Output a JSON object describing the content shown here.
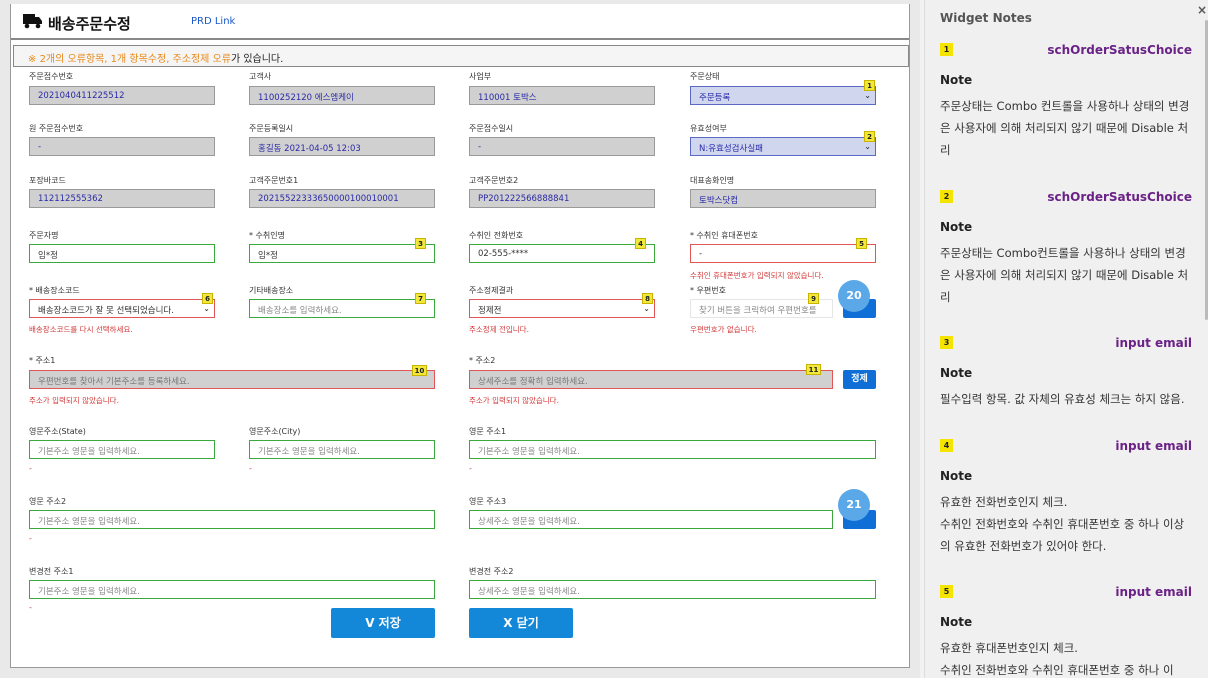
{
  "window": {
    "title": "배송주문수정",
    "prd_link": "PRD Link",
    "error_prefix": "※ ",
    "error_highlight": "2개의 오류항목, 1개 항목수정, 주소정제 오류",
    "error_suffix": "가 있습니다."
  },
  "form": {
    "row1": {
      "order_no": {
        "label": "주문접수번호",
        "value": "2021040411225512"
      },
      "customer": {
        "label": "고객사",
        "value": "1100252120 에스엠케이"
      },
      "business": {
        "label": "사업부",
        "value": "110001 토박스"
      },
      "status": {
        "label": "주문상태",
        "value": "주문등록"
      }
    },
    "row2": {
      "orig_order_no": {
        "label": "원 주문접수번호",
        "value": "-"
      },
      "reg_date": {
        "label": "주문등록일시",
        "value": "홍길동 2021-04-05 12:03"
      },
      "recv_date": {
        "label": "주문접수일시",
        "value": "-"
      },
      "validity": {
        "label": "유효성여부",
        "value": "N:유효성검사실패"
      }
    },
    "row3": {
      "barcode": {
        "label": "포장바코드",
        "value": "112112555362"
      },
      "cust_order_no1": {
        "label": "고객주문번호1",
        "value": "20215522333650000100010001"
      },
      "cust_order_no2": {
        "label": "고객주문번호2",
        "value": "PP201222566888841"
      },
      "shipper": {
        "label": "대표송화인명",
        "value": "토박스닷컴"
      }
    },
    "row4": {
      "orderer": {
        "label": "주문자명",
        "value": "임*정"
      },
      "recipient": {
        "label": "* 수취인명",
        "value": "임*정"
      },
      "phone": {
        "label": "수취인 전화번호",
        "value": "02-555-****"
      },
      "mobile": {
        "label": "* 수취인 휴대폰번호",
        "value": "-",
        "error": "수취인 휴대폰번호가 입력되지 않았습니다."
      }
    },
    "row5": {
      "place_code": {
        "label": "* 배송장소코드",
        "value": "배송장소코드가 잘 못 선택되었습니다.",
        "error": "배송장소코드를 다시 선택하세요."
      },
      "other_place": {
        "label": "기타배송장소",
        "placeholder": "배송장소를 입력하세요."
      },
      "refine_result": {
        "label": "주소정제결과",
        "value": "정제전",
        "error": "주소정제 전입니다."
      },
      "zip": {
        "label": "* 우편번호",
        "placeholder": "찾기 버튼을 크릭하여 우편번호를",
        "error": "우편번호가 없습니다."
      }
    },
    "row6": {
      "addr1": {
        "label": "* 주소1",
        "placeholder": "우편번호를 찾아서 기본주소를 등록하세요.",
        "error": "주소가 입력되지 않았습니다."
      },
      "addr2": {
        "label": "* 주소2",
        "placeholder": "상세주소를 정확히 입력하세요.",
        "error": "주소가 입력되지 않았습니다."
      },
      "refine_button": "정제"
    },
    "row7": {
      "state": {
        "label": "영문주소(State)",
        "placeholder": "기본주소 영문을 입력하세요."
      },
      "city": {
        "label": "영문주소(City)",
        "placeholder": "기본주소 영문을 입력하세요."
      },
      "en_addr1": {
        "label": "영문 주소1",
        "placeholder": "기본주소 영문을 입력하세요."
      }
    },
    "row8": {
      "en_addr2": {
        "label": "영문 주소2",
        "placeholder": "기본주소 영문을 입력하세요."
      },
      "en_addr3": {
        "label": "영문 주소3",
        "placeholder": "상세주소 영문을 입력하세요."
      }
    },
    "row9": {
      "prev_addr1": {
        "label": "변경전 주소1",
        "placeholder": "기본주소 영문을 입력하세요."
      },
      "prev_addr2": {
        "label": "변경전 주소2",
        "placeholder": "상세주소 영문을 입력하세요."
      }
    },
    "dash": "-",
    "buttons": {
      "save": "V  저장",
      "close": "X  닫기"
    },
    "badges": [
      "1",
      "2",
      "3",
      "4",
      "5",
      "6",
      "7",
      "8",
      "9",
      "10",
      "11"
    ],
    "circles": [
      "20",
      "21"
    ]
  },
  "notes": {
    "title": "Widget Notes",
    "close": "×",
    "items": [
      {
        "num": "1",
        "widget": "schOrderSatusChoice",
        "label": "Note",
        "text": "주문상태는 Combo 컨트롤을 사용하나 상태의 변경은 사용자에 의해 처리되지 않기 때문에 Disable 처리"
      },
      {
        "num": "2",
        "widget": "schOrderSatusChoice",
        "label": "Note",
        "text": "주문상태는 Combo컨트롤을 사용하나 상태의 변경은 사용자에 의해 처리되지 않기 때문에 Disable 처리"
      },
      {
        "num": "3",
        "widget": "input email",
        "label": "Note",
        "text": "필수입력 항목. 값 자체의 유효성 체크는 하지 않음."
      },
      {
        "num": "4",
        "widget": "input email",
        "label": "Note",
        "text": "유효한 전화번호인지 체크.\n수취인 전화번호와 수취인 휴대폰번호 중 하나 이상의 유효한 전화번호가 있어야 한다."
      },
      {
        "num": "5",
        "widget": "input email",
        "label": "Note",
        "text": "유효한 휴대폰번호인지 체크.\n수취인 전화번호와 수취인 휴대폰번호 중 하나 이"
      }
    ]
  }
}
